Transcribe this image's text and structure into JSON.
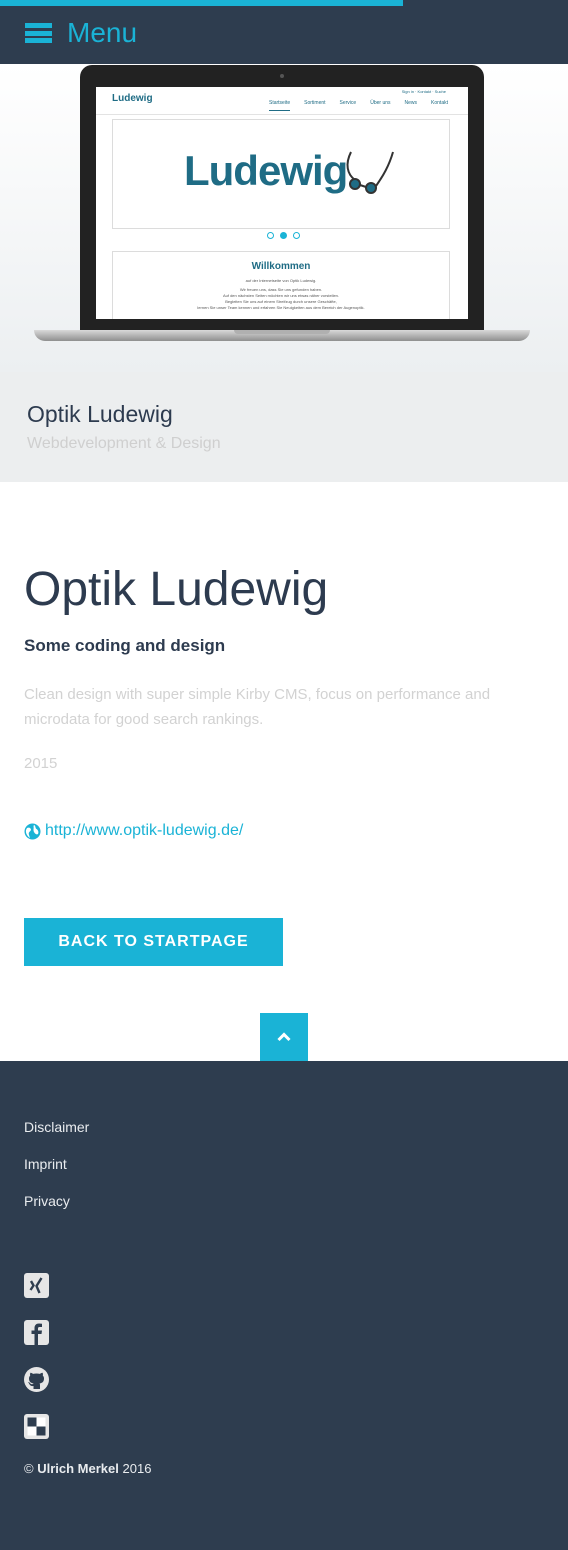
{
  "header": {
    "menu_label": "Menu",
    "accent_color": "#1ab3d6",
    "background_color": "#2e3d4f",
    "scroll_progress_fraction": 0.71
  },
  "hero": {
    "screenshot": {
      "logo_small": "Ludewig",
      "util_links": "Sign in · Kontakt · Suche",
      "nav": [
        "Startseite",
        "Sortiment",
        "Service",
        "Über uns",
        "News",
        "Kontakt"
      ],
      "active_nav_index": 0,
      "logo_big": "Ludewig",
      "welcome_title": "Willkommen",
      "welcome_lines": [
        "auf der Internetseite von Optik Ludewig.",
        "Wir freuen uns, dass Sie uns gefunden haben.",
        "Auf den nächsten Seiten möchten wir uns etwas näher vorstellen.",
        "Begleiten Sie uns auf einem Streifzug durch unsere Geschäfte,",
        "lernen Sie unser Team kennen und erfahren Sie Neuigkeiten aus dem Bereich der Augenoptik."
      ],
      "slide_count": 3,
      "active_slide_index": 1
    }
  },
  "caption": {
    "title": "Optik Ludewig",
    "subtitle": "Webdevelopment & Design"
  },
  "project": {
    "title": "Optik Ludewig",
    "subtitle": "Some coding and design",
    "description": "Clean design with super simple Kirby CMS, focus on performance and microdata for good search rankings.",
    "year": "2015",
    "link_text": "http://www.optik-ludewig.de/",
    "back_button_label": "BACK TO STARTPAGE"
  },
  "footer": {
    "links": [
      "Disclaimer",
      "Imprint",
      "Privacy"
    ],
    "social_icons": [
      "xing-icon",
      "facebook-icon",
      "github-icon",
      "delicious-icon"
    ],
    "copyright_symbol": "©",
    "copyright_name": "Ulrich Merkel",
    "copyright_year": "2016"
  }
}
